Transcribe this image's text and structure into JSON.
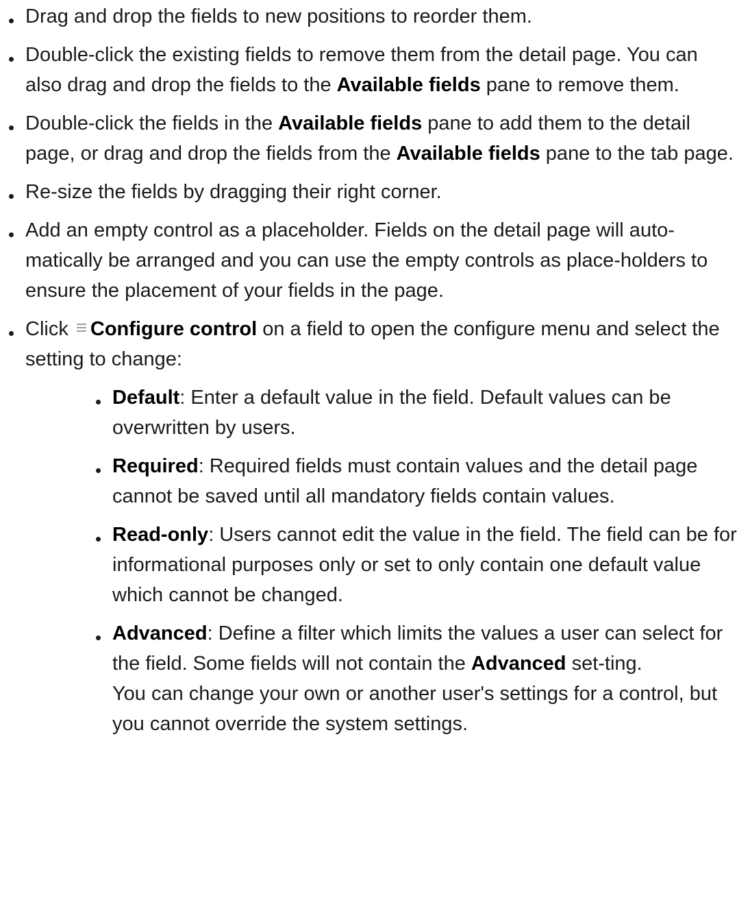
{
  "bullets": {
    "b1": {
      "text": "Drag and drop the fields to new positions to reorder them."
    },
    "b2": {
      "part1": "Double-click the existing fields to remove them from the detail page. You can also drag and drop the fields to the ",
      "bold1": "Available fields",
      "part2": " pane to remove them."
    },
    "b3": {
      "part1": "Double-click the fields in the ",
      "bold1": "Available fields",
      "part2": " pane to add them to the detail page, or drag and drop the fields from the ",
      "bold2": "Available fields",
      "part3": " pane to the tab page."
    },
    "b4": {
      "text": "Re-size the fields by dragging their right corner."
    },
    "b5": {
      "text": "Add an empty control as a placeholder. Fields on the detail page will auto-matically be arranged and you can use the empty controls as place-holders to ensure the placement of your fields in the page."
    },
    "b6": {
      "part1": "Click ",
      "icon": "menu-lines-icon",
      "bold1": "Configure control",
      "part2": " on a field to open the configure menu and select the setting to change:",
      "sub": {
        "default": {
          "term": "Default",
          "text": ": Enter a default value in the field. Default values can be overwritten by users."
        },
        "required": {
          "term": "Required",
          "text": ": Required fields must contain values and the detail page cannot be saved until all mandatory fields contain values."
        },
        "readonly": {
          "term": "Read-only",
          "text": ": Users cannot edit the value in the field. The field can be for informational purposes only or set to only contain one default value which cannot be changed."
        },
        "advanced": {
          "term": "Advanced",
          "text1": ": Define a filter which limits the values a user can select for the field. Some fields will not contain the ",
          "bold": "Advanced",
          "text2": " set-ting.",
          "note": "You can change your own or another user's settings for a control, but you cannot override the system settings."
        }
      }
    }
  }
}
